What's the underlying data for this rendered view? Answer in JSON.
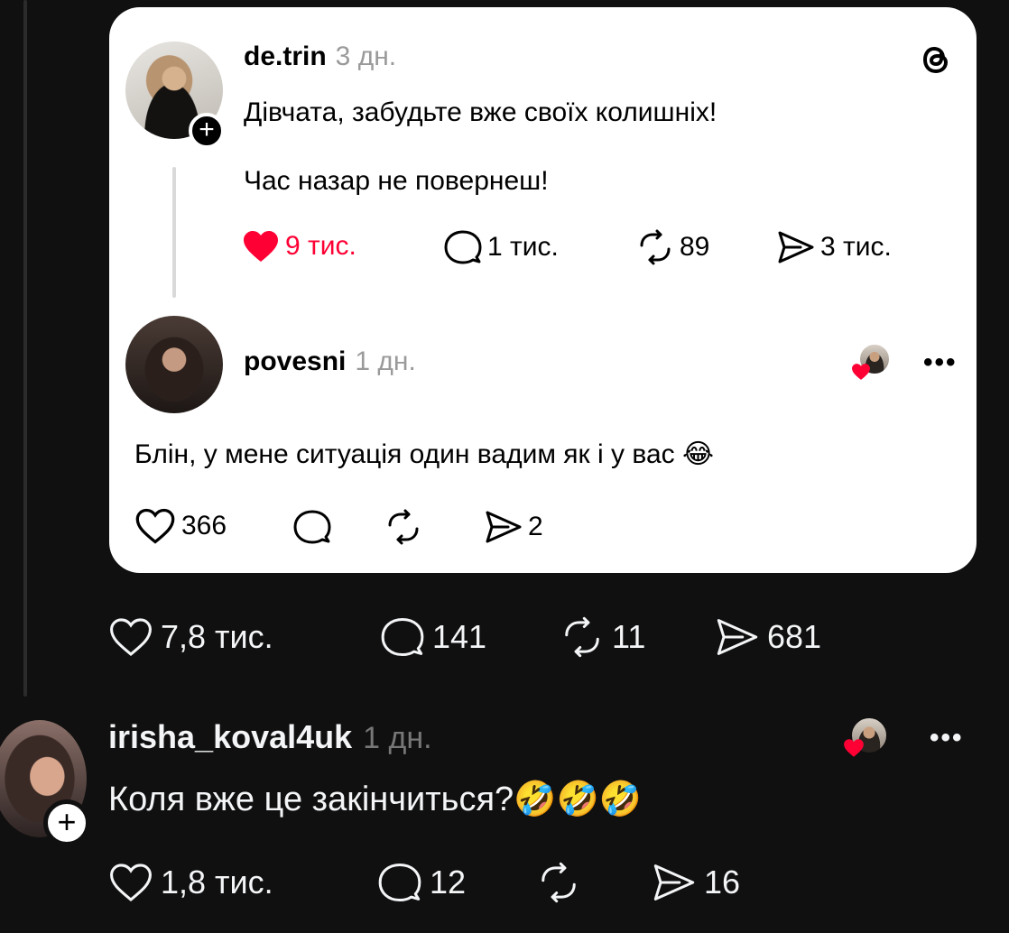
{
  "quoted_post": {
    "username": "de.trin",
    "time": "3 дн.",
    "line1": "Дівчата, забудьте вже своїх колишніх!",
    "line2": "Час назар не повернеш!",
    "likes": "9 тис.",
    "replies": "1 тис.",
    "reposts": "89",
    "shares": "3 тис.",
    "liked": true,
    "app_icon": "threads-logo-icon"
  },
  "quoted_reply": {
    "username": "povesni",
    "time": "1 дн.",
    "text": "Блін, у мене ситуація один вадим як і у вас 😂",
    "likes": "366",
    "shares": "2"
  },
  "post_metrics": {
    "likes": "7,8 тис.",
    "replies": "141",
    "reposts": "11",
    "shares": "681"
  },
  "comment": {
    "username": "irisha_koval4uk",
    "time": "1 дн.",
    "text": "Коля вже це закінчиться?🤣🤣🤣",
    "likes": "1,8 тис.",
    "replies": "12",
    "shares": "16"
  },
  "colors": {
    "heart_red": "#ff0034",
    "background": "#101010",
    "card": "#ffffff"
  }
}
